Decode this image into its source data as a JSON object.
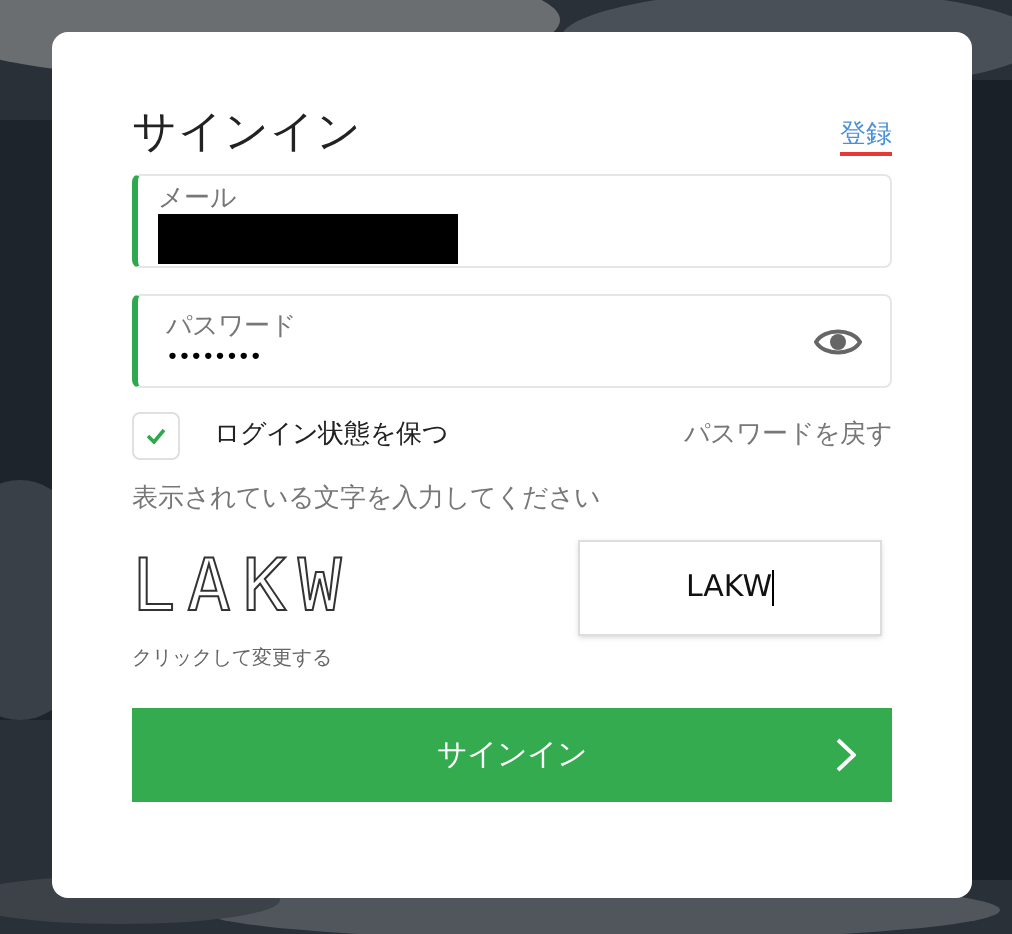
{
  "title": "サインイン",
  "register_link": "登録",
  "email": {
    "label": "メール",
    "redacted": true
  },
  "password": {
    "label": "パスワード",
    "value": "••••••••"
  },
  "remember": {
    "label": "ログイン状態を保つ",
    "checked": true
  },
  "reset_link": "パスワードを戻す",
  "captcha": {
    "instruction": "表示されている文字を入力してください",
    "image_text": "LAKW",
    "value": "LAKW",
    "refresh_hint": "クリックして変更する"
  },
  "submit": {
    "label": "サインイン"
  }
}
